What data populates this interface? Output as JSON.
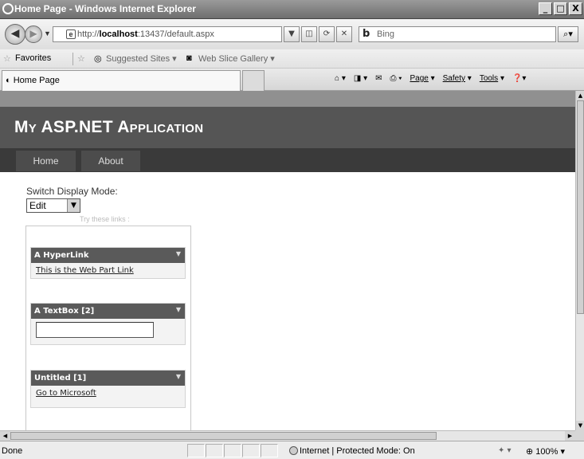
{
  "window": {
    "title": "Home Page - Windows Internet Explorer",
    "min": "_",
    "max": "□",
    "close": "X"
  },
  "address": {
    "url_prefix": "http://",
    "url_host": "localhost",
    "url_rest": ":13437/default.aspx",
    "search_placeholder": "Bing"
  },
  "favorites": {
    "label": "Favorites",
    "items": [
      "Suggested Sites ▾",
      "Web Slice Gallery ▾"
    ]
  },
  "tab": {
    "label": "Home Page"
  },
  "command_bar": {
    "page": "Page",
    "safety": "Safety",
    "tools": "Tools"
  },
  "site": {
    "title": "My ASP.NET Application",
    "menu": [
      "Home",
      "About"
    ]
  },
  "display_mode": {
    "label": "Switch Display Mode:",
    "selected": "Edit"
  },
  "zone": {
    "title": "Try these links :",
    "parts": [
      {
        "title": "A HyperLink",
        "link": "This is the Web Part Link"
      },
      {
        "title": "A TextBox [2]",
        "value": ""
      },
      {
        "title": "Untitled [1]",
        "link": "Go to Microsoft"
      }
    ]
  },
  "status": {
    "text": "Done",
    "zone": "Internet | Protected Mode: On",
    "zoom": "100%"
  }
}
